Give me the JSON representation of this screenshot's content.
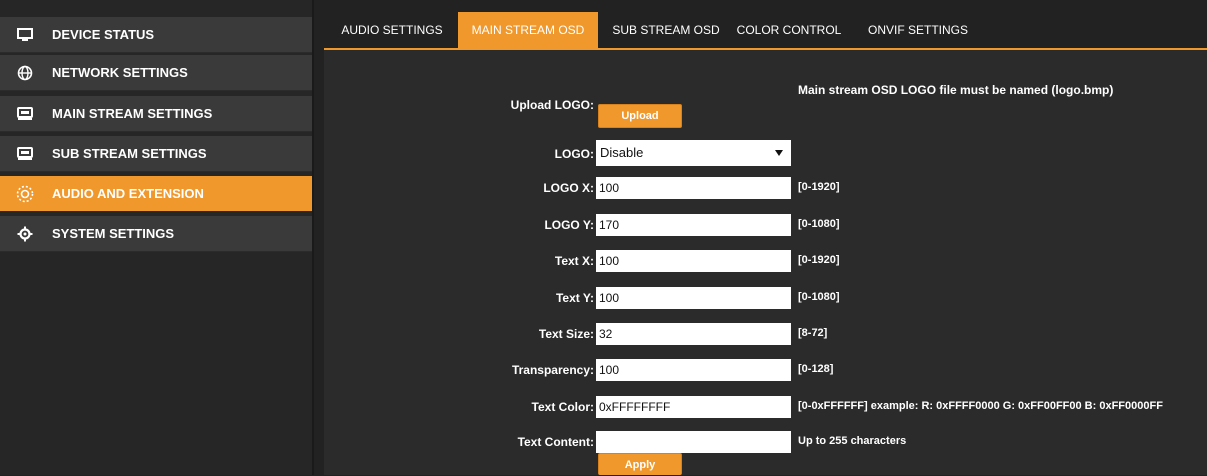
{
  "sidebar": {
    "items": [
      {
        "label": "DEVICE STATUS",
        "icon": "monitor-icon"
      },
      {
        "label": "NETWORK SETTINGS",
        "icon": "globe-icon"
      },
      {
        "label": "MAIN STREAM SETTINGS",
        "icon": "camera-icon"
      },
      {
        "label": "SUB STREAM SETTINGS",
        "icon": "camera-icon"
      },
      {
        "label": "AUDIO AND EXTENSION",
        "icon": "sun-icon",
        "active": true
      },
      {
        "label": "SYSTEM SETTINGS",
        "icon": "gear-icon"
      }
    ]
  },
  "tabs": [
    {
      "label": "AUDIO SETTINGS"
    },
    {
      "label": "MAIN STREAM OSD",
      "active": true
    },
    {
      "label": "SUB STREAM OSD"
    },
    {
      "label": "COLOR CONTROL"
    },
    {
      "label": "ONVIF SETTINGS"
    }
  ],
  "form": {
    "upload_logo_label": "Upload LOGO:",
    "upload_button": "Upload",
    "logo_note": "Main stream OSD LOGO file must be named (logo.bmp)",
    "logo_label": "LOGO:",
    "logo_value": "Disable",
    "logo_x": {
      "label": "LOGO X:",
      "value": "100",
      "hint": "[0-1920]"
    },
    "logo_y": {
      "label": "LOGO Y:",
      "value": "170",
      "hint": "[0-1080]"
    },
    "text_x": {
      "label": "Text X:",
      "value": "100",
      "hint": "[0-1920]"
    },
    "text_y": {
      "label": "Text Y:",
      "value": "100",
      "hint": "[0-1080]"
    },
    "text_size": {
      "label": "Text Size:",
      "value": "32",
      "hint": "[8-72]"
    },
    "transparency": {
      "label": "Transparency:",
      "value": "100",
      "hint": "[0-128]"
    },
    "text_color": {
      "label": "Text Color:",
      "value": "0xFFFFFFFF",
      "hint": "[0-0xFFFFFF] example: R: 0xFFFF0000 G: 0xFF00FF00 B: 0xFF0000FF"
    },
    "text_content": {
      "label": "Text Content:",
      "value": "",
      "hint": "Up to 255 characters"
    },
    "apply_button": "Apply"
  },
  "colors": {
    "accent": "#f0982b",
    "panel": "#2b2b2b",
    "sidebar_item": "#3a3a3a"
  }
}
